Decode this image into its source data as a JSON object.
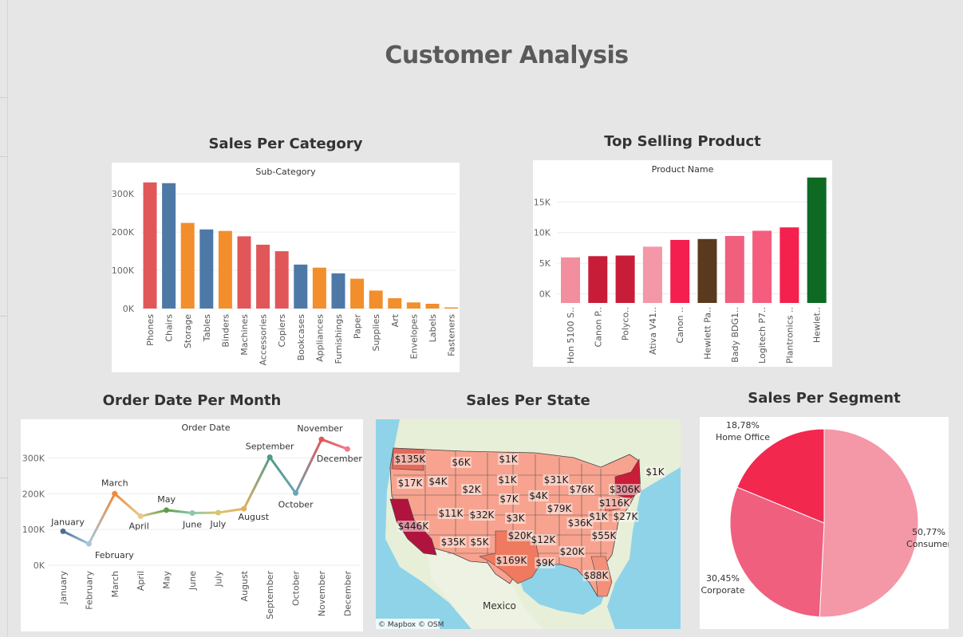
{
  "page_title": "Customer Analysis",
  "sections": {
    "category": "Sales Per Category",
    "product": "Top Selling Product",
    "month": "Order Date Per Month",
    "state": "Sales Per State",
    "segment": "Sales Per Segment"
  },
  "colors": {
    "red": "#e15759",
    "blue": "#4e79a7",
    "orange": "#f28e2b",
    "product_palette": [
      "#f28e9e",
      "#c71d38",
      "#c71d38",
      "#f497a7",
      "#f41f4e",
      "#5a3a1f",
      "#f05f7e",
      "#f55c7e",
      "#f4204e",
      "#0e6a23"
    ],
    "segment_palette": [
      "#f497a7",
      "#f05f7e",
      "#f2284f"
    ]
  },
  "chart_data": [
    {
      "id": "category",
      "type": "bar",
      "header": "Sub-Category",
      "categories": [
        "Phones",
        "Chairs",
        "Storage",
        "Tables",
        "Binders",
        "Machines",
        "Accessories",
        "Copiers",
        "Bookcases",
        "Appliances",
        "Furnishings",
        "Paper",
        "Supplies",
        "Art",
        "Envelopes",
        "Labels",
        "Fasteners"
      ],
      "values": [
        330000,
        328000,
        224000,
        207000,
        203000,
        189000,
        167000,
        150000,
        115000,
        107000,
        92000,
        78000,
        47000,
        27000,
        16000,
        12500,
        3000
      ],
      "color_groups": [
        "red",
        "blue",
        "orange",
        "blue",
        "orange",
        "red",
        "red",
        "red",
        "blue",
        "orange",
        "blue",
        "orange",
        "orange",
        "orange",
        "orange",
        "orange",
        "orange"
      ],
      "yticks": [
        0,
        100000,
        200000,
        300000
      ],
      "ytick_labels": [
        "0K",
        "100K",
        "200K",
        "300K"
      ],
      "ylim": [
        0,
        340000
      ]
    },
    {
      "id": "product",
      "type": "bar",
      "header": "Product Name",
      "categories": [
        "Hon 5100 S..",
        "Canon P..",
        "Polyco..",
        "Ativa V41..",
        "Canon ..",
        "Hewlett Pa..",
        "Bady BDG1..",
        "Logitech P7..",
        "Plantronics ..",
        "Hewlet.."
      ],
      "values": [
        5950,
        6150,
        6250,
        7700,
        8800,
        8950,
        9450,
        10300,
        10850,
        19000
      ],
      "yticks": [
        0,
        5000,
        10000,
        15000
      ],
      "ytick_labels": [
        "0K",
        "5K",
        "10K",
        "15K"
      ],
      "ylim": [
        -1500,
        20000
      ]
    },
    {
      "id": "month",
      "type": "line",
      "header": "Order Date",
      "categories": [
        "January",
        "February",
        "March",
        "April",
        "May",
        "June",
        "July",
        "August",
        "September",
        "October",
        "November",
        "December"
      ],
      "values": [
        95000,
        60000,
        200000,
        137000,
        154000,
        146000,
        147000,
        158000,
        302000,
        202000,
        352000,
        325000
      ],
      "point_labels": [
        "January",
        "February",
        "March",
        "April",
        "May",
        "June",
        "July",
        "August",
        "September",
        "October",
        "November",
        "December"
      ],
      "yticks": [
        0,
        100000,
        200000,
        300000
      ],
      "ytick_labels": [
        "0K",
        "100K",
        "200K",
        "300K"
      ],
      "ylim": [
        0,
        370000
      ]
    },
    {
      "id": "state",
      "type": "map",
      "labels": [
        "$135K",
        "$6K",
        "$1K",
        "$17K",
        "$4K",
        "$2K",
        "$1K",
        "$31K",
        "$76K",
        "$306K",
        "$1K",
        "$7K",
        "$4K",
        "$79K",
        "$116K",
        "$11K",
        "$32K",
        "$3K",
        "$1K",
        "$27K",
        "$36K",
        "$446K",
        "$35K",
        "$5K",
        "$20K",
        "$12K",
        "$55K",
        "$20K",
        "$169K",
        "$9K",
        "$88K"
      ],
      "place_label": "Mexico",
      "attribution": "© Mapbox © OSM"
    },
    {
      "id": "segment",
      "type": "pie",
      "slices": [
        {
          "name": "Consumer",
          "percent": "50,77%",
          "value": 50.77
        },
        {
          "name": "Corporate",
          "percent": "30,45%",
          "value": 30.45
        },
        {
          "name": "Home Office",
          "percent": "18,78%",
          "value": 18.78
        }
      ]
    }
  ]
}
